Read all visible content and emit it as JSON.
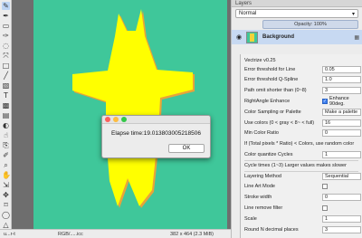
{
  "toolbar": {
    "tools": [
      {
        "icon": "pencil-icon",
        "glyph": "✎"
      },
      {
        "icon": "pen-icon",
        "glyph": "✒"
      },
      {
        "icon": "rect-select-icon",
        "glyph": "▭"
      },
      {
        "icon": "brush-icon",
        "glyph": "✑"
      },
      {
        "icon": "lasso-icon",
        "glyph": "◌"
      },
      {
        "icon": "path-icon",
        "glyph": "⤧"
      },
      {
        "icon": "rectangle-icon",
        "glyph": "□"
      },
      {
        "icon": "polyline-icon",
        "glyph": "╱"
      },
      {
        "icon": "eraser-icon",
        "glyph": "▧"
      },
      {
        "icon": "text-icon",
        "glyph": "T"
      },
      {
        "icon": "fill-icon",
        "glyph": "▩"
      },
      {
        "icon": "gradient-icon",
        "glyph": "▤"
      },
      {
        "icon": "dodge-icon",
        "glyph": "◐"
      },
      {
        "icon": "smudge-icon",
        "glyph": "☝"
      },
      {
        "icon": "clone-icon",
        "glyph": "⎘"
      },
      {
        "icon": "eyedropper-icon",
        "glyph": "✐"
      },
      {
        "icon": "zoom-icon",
        "glyph": "⌕"
      },
      {
        "icon": "hand-icon",
        "glyph": "✋"
      },
      {
        "icon": "transform-icon",
        "glyph": "⇲"
      },
      {
        "icon": "move-icon",
        "glyph": "✥"
      },
      {
        "icon": "crop-icon",
        "glyph": "⌑"
      },
      {
        "icon": "shape-icon",
        "glyph": "◯"
      },
      {
        "icon": "symmetry-icon",
        "glyph": "△"
      },
      {
        "icon": "palette-icon",
        "glyph": "▣"
      },
      {
        "icon": "layer-icon",
        "glyph": "☰"
      }
    ]
  },
  "canvas": {
    "background_color": "#3fc79a",
    "figure_color": "#ffff00",
    "figure_shadow_color": "#e8a33a"
  },
  "statusbar": {
    "zoom": "u...r-t",
    "profile": "RGB/.....icc",
    "dimensions": "382 x 464 (2.3 MiB)"
  },
  "layers": {
    "panel_title": "Layers",
    "blend_mode": "Normal",
    "opacity_label": "Opacity:  100%",
    "layer_name": "Background"
  },
  "plugin": {
    "title": "Vectrize v0.25",
    "fields": [
      {
        "label": "Error threshold for Line",
        "value": "0.05"
      },
      {
        "label": "Error threshold Q-Spline",
        "value": "1.0"
      },
      {
        "label": "Path omit shorter than (0~8)",
        "value": "3"
      },
      {
        "label": "RightAngle Enhance",
        "check": "Enhance 90deg."
      },
      {
        "label": "Color Sampling or Palette",
        "value": "Make a palette"
      },
      {
        "label": "Use colors (0 < gray < 8~ < full)",
        "value": "16"
      },
      {
        "label": "Min Color Ratio",
        "value": "0"
      },
      {
        "label": "If (Total pixels * Ratio) < Colors,  use random color",
        "value": ""
      },
      {
        "label": "Color quantize Cycles",
        "value": "1"
      },
      {
        "label": "Cycle times (1~3) Larger values makes slower",
        "value": ""
      },
      {
        "label": "Layering Method",
        "value": "Sequential"
      },
      {
        "label": "Line Art Mode",
        "check": ""
      },
      {
        "label": "Stroke width",
        "value": "0"
      },
      {
        "label": "Line remove filter",
        "check": ""
      },
      {
        "label": "Scale",
        "value": "1"
      },
      {
        "label": "Round N decimal places",
        "value": "3"
      }
    ]
  },
  "alert": {
    "message": "Elapse time:19.013803005218506",
    "ok_label": "OK"
  }
}
